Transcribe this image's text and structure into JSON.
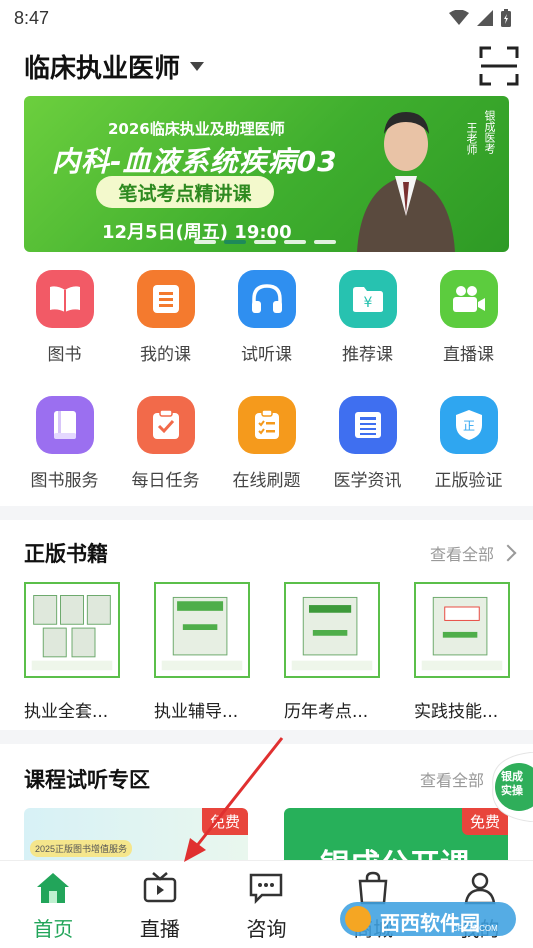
{
  "status_bar": {
    "time": "8:47"
  },
  "header": {
    "exam_title": "临床执业医师"
  },
  "banner": {
    "year_line": "2026临床执业及助理医师",
    "title": "内科-血液系统疾病03",
    "pill": "笔试考点精讲课",
    "datetime": "12月5日(周五) 19:00",
    "side_brand": "银成医考",
    "side_teacher": "王老师",
    "dot_count": 5,
    "active_dot": 1
  },
  "grid_row1": [
    {
      "label": "图书",
      "icon": "book-open-icon",
      "color": "#f25a66"
    },
    {
      "label": "我的课",
      "icon": "list-doc-icon",
      "color": "#f47a2e"
    },
    {
      "label": "试听课",
      "icon": "headphones-icon",
      "color": "#2f8ff0"
    },
    {
      "label": "推荐课",
      "icon": "folder-yen-icon",
      "color": "#27c2b0"
    },
    {
      "label": "直播课",
      "icon": "video-camera-icon",
      "color": "#5ccc3e"
    }
  ],
  "grid_row2": [
    {
      "label": "图书服务",
      "icon": "book-icon",
      "color": "#9b6ff0"
    },
    {
      "label": "每日任务",
      "icon": "task-check-icon",
      "color": "#f26a4a"
    },
    {
      "label": "在线刷题",
      "icon": "clipboard-list-icon",
      "color": "#f59a1c"
    },
    {
      "label": "医学资讯",
      "icon": "news-icon",
      "color": "#3f6ff0"
    },
    {
      "label": "正版验证",
      "icon": "shield-zheng-icon",
      "color": "#2fa6f0"
    }
  ],
  "books_section": {
    "title": "正版书籍",
    "see_all": "查看全部",
    "items": [
      {
        "title": "执业全套..."
      },
      {
        "title": "执业辅导..."
      },
      {
        "title": "历年考点..."
      },
      {
        "title": "实践技能..."
      }
    ]
  },
  "courses_section": {
    "title": "课程试听专区",
    "see_all": "查看全部",
    "cards": [
      {
        "badge": "免费",
        "text": "2025正版图书增值服务"
      },
      {
        "badge": "免费",
        "text": "银成公开课"
      }
    ]
  },
  "float_badge": {
    "text": "银成实操"
  },
  "tabbar": [
    {
      "label": "首页",
      "icon": "home-icon",
      "active": true
    },
    {
      "label": "直播",
      "icon": "tv-icon",
      "active": false
    },
    {
      "label": "咨询",
      "icon": "chat-icon",
      "active": false
    },
    {
      "label": "商城",
      "icon": "shopping-bag-icon",
      "active": false
    },
    {
      "label": "我的",
      "icon": "user-icon",
      "active": false
    }
  ],
  "watermark": {
    "text": "西西软件园",
    "sub": "CR173.COM"
  },
  "colors": {
    "accent_green": "#22a55a",
    "banner_green": "#3fae2e",
    "free_red": "#e8453c"
  }
}
